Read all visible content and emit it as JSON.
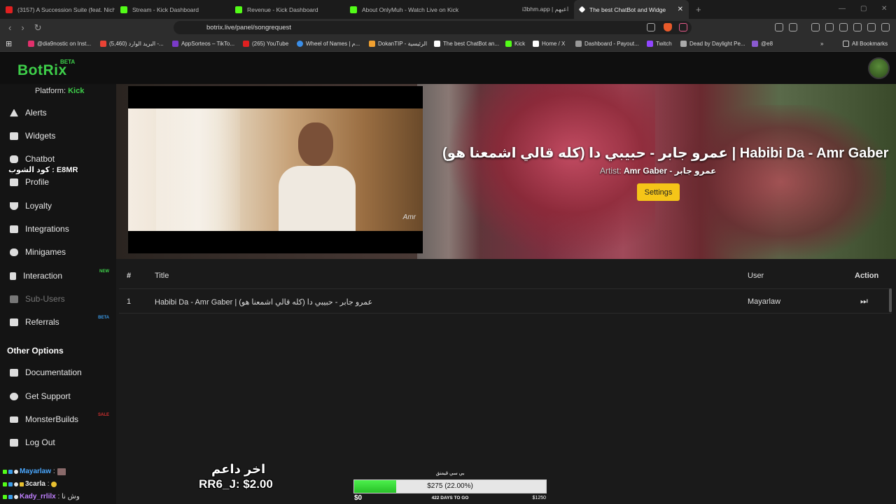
{
  "browser": {
    "tabs": [
      {
        "label": "(3157) A Succession Suite (feat. Nich",
        "color": "#e02020"
      },
      {
        "label": "Stream - Kick Dashboard",
        "color": "#53fc18"
      },
      {
        "label": "Revenue - Kick Dashboard",
        "color": "#53fc18"
      },
      {
        "label": "About OnlyMuh - Watch Live on Kick",
        "color": "#53fc18"
      },
      {
        "label": "i3bhm.app | اعبهم",
        "color": "#444444"
      },
      {
        "label": "The best ChatBot and Widge",
        "color": "#ffffff"
      }
    ],
    "url": "botrix.live/panel/songrequest",
    "bookmarks": [
      {
        "label": "@dia9nostic on Inst...",
        "color": "#e1306c"
      },
      {
        "label": "(5,460) البريد الوارد -...",
        "color": "#ea4335"
      },
      {
        "label": "AppSorteos – TikTo...",
        "color": "#7a3ac8"
      },
      {
        "label": "(265) YouTube",
        "color": "#e02020"
      },
      {
        "label": "Wheel of Names | م...",
        "color": "#3a8ee8"
      },
      {
        "label": "DokanTIP - الرئيسية",
        "color": "#f0a030"
      },
      {
        "label": "The best ChatBot an...",
        "color": "#ffffff"
      },
      {
        "label": "Kick",
        "color": "#53fc18"
      },
      {
        "label": "Home / X",
        "color": "#ffffff"
      },
      {
        "label": "Dashboard - Payout...",
        "color": "#999999"
      },
      {
        "label": "Twitch",
        "color": "#9146ff"
      },
      {
        "label": "Dead by Daylight Pe...",
        "color": "#aaaaaa"
      },
      {
        "label": "@e8",
        "color": "#8a5ad0"
      }
    ],
    "all_bookmarks": "All Bookmarks"
  },
  "app": {
    "logo": "BotRix",
    "logo_badge": "BETA",
    "platform_label": "Platform:",
    "platform_value": "Kick"
  },
  "sidebar": {
    "items": [
      {
        "label": "Alerts",
        "badge": ""
      },
      {
        "label": "Widgets",
        "badge": ""
      },
      {
        "label": "Chatbot",
        "badge": ""
      },
      {
        "label": "Profile",
        "badge": ""
      },
      {
        "label": "Loyalty",
        "badge": ""
      },
      {
        "label": "Integrations",
        "badge": ""
      },
      {
        "label": "Minigames",
        "badge": ""
      },
      {
        "label": "Interaction",
        "badge": "NEW"
      },
      {
        "label": "Sub-Users",
        "badge": ""
      },
      {
        "label": "Referrals",
        "badge": "BETA"
      }
    ],
    "other_title": "Other Options",
    "other_items": [
      {
        "label": "Documentation",
        "badge": ""
      },
      {
        "label": "Get Support",
        "badge": ""
      },
      {
        "label": "MonsterBuilds",
        "badge": "SALE"
      },
      {
        "label": "Log Out",
        "badge": ""
      }
    ],
    "overlay_code": "كود الشوب : E8MR"
  },
  "now_playing": {
    "title": "عمرو جابر - حبيبي دا (كله قالي اشمعنا هو) | Habibi Da - Amr Gaber",
    "artist_label": "Artist:",
    "artist": "Amr Gaber - عمرو جابر",
    "settings_button": "Settings",
    "video_signature": "Amr"
  },
  "queue": {
    "headers": {
      "num": "#",
      "title": "Title",
      "user": "User",
      "action": "Action"
    },
    "rows": [
      {
        "num": "1",
        "title": "Habibi Da - Amr Gaber | عمرو جابر - حبيبي دا (كله قالي اشمعنا هو)",
        "user": "Mayarlaw",
        "action": "⏭"
      }
    ]
  },
  "chat": [
    {
      "user": "Mayarlaw",
      "text": ":",
      "color": "#4aa8ff"
    },
    {
      "user": "3carla",
      "text": ":",
      "color": "#e8e8e8"
    },
    {
      "user": "Kady_rrlilx",
      "text": ": وش نا",
      "color": "#c080ff"
    }
  ],
  "last_tip": {
    "title": "اخر داعم",
    "text": "RR6_J: $2.00"
  },
  "goal": {
    "title": "بي سي قيمنق",
    "progress": 0.22,
    "bar_text": "$275 (22.00%)",
    "start": "$0",
    "days": "422 DAYS TO GO",
    "target": "$1250"
  }
}
